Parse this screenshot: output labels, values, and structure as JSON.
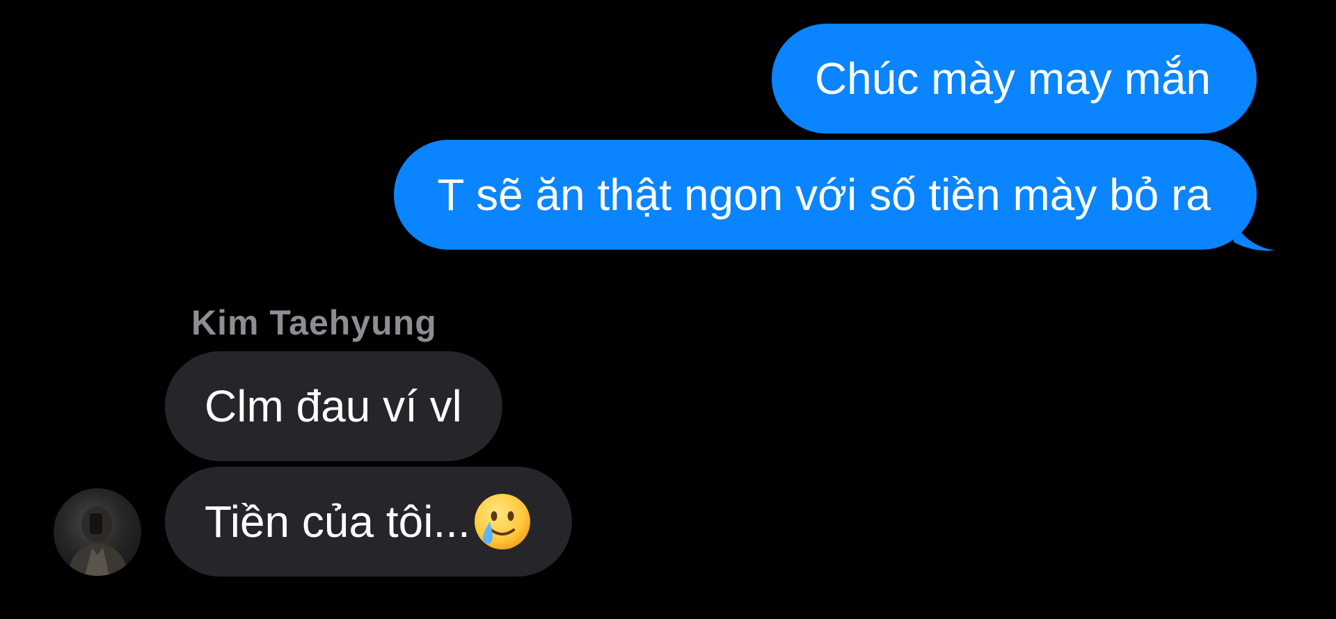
{
  "conversation": {
    "outgoing": [
      {
        "text": "Chúc mày may mắn"
      },
      {
        "text": "T sẽ ăn thật ngon với số tiền mày bỏ ra"
      }
    ],
    "sender_name": "Kim Taehyung",
    "incoming": [
      {
        "text": "Clm đau ví vl"
      },
      {
        "text": "Tiền của tôi...",
        "emoji": "smiling-face-with-tear-icon"
      }
    ]
  },
  "colors": {
    "background": "#000000",
    "outgoing_bubble": "#0a84ff",
    "incoming_bubble": "#26252a",
    "sender_name": "#8d8d93",
    "message_text": "#ffffff"
  },
  "icons": {
    "avatar": "contact-avatar-photo",
    "bubble_tail": "bubble-tail-icon"
  }
}
